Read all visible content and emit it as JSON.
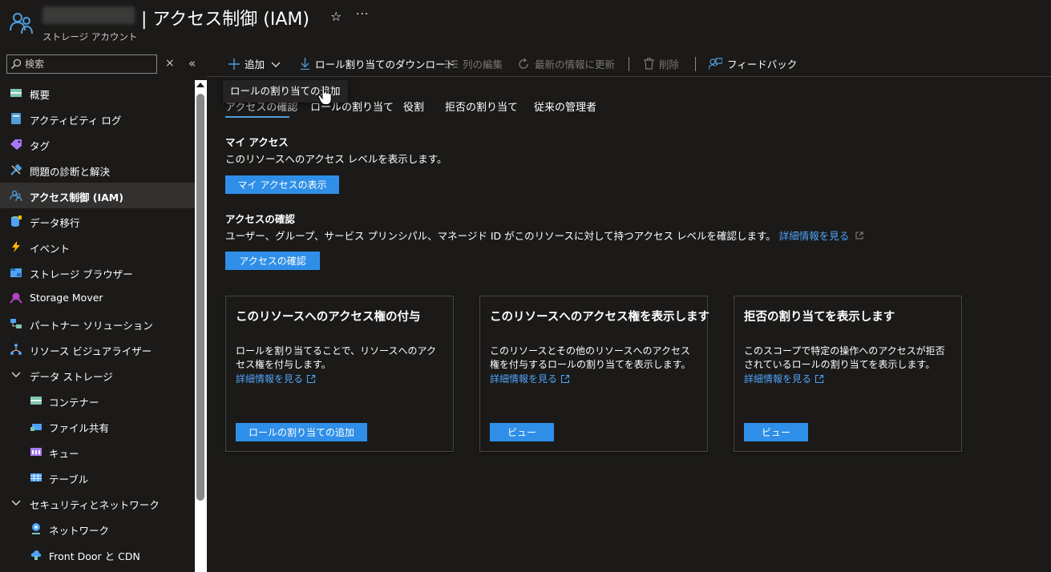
{
  "header": {
    "title": "| アクセス制御 (IAM)",
    "subtitle": "ストレージ アカウント",
    "favorite_icon": "star-icon",
    "more_icon": "ellipsis-icon"
  },
  "sidebar": {
    "search_placeholder": "検索",
    "items": [
      {
        "label": "概要",
        "icon": "overview-icon"
      },
      {
        "label": "アクティビティ ログ",
        "icon": "activity-log-icon"
      },
      {
        "label": "タグ",
        "icon": "tag-icon"
      },
      {
        "label": "問題の診断と解決",
        "icon": "wrench-icon"
      },
      {
        "label": "アクセス制御 (IAM)",
        "icon": "iam-icon"
      },
      {
        "label": "データ移行",
        "icon": "data-migration-icon"
      },
      {
        "label": "イベント",
        "icon": "lightning-icon"
      },
      {
        "label": "ストレージ ブラウザー",
        "icon": "storage-browser-icon"
      },
      {
        "label": "Storage Mover",
        "icon": "storage-mover-icon"
      },
      {
        "label": "パートナー ソリューション",
        "icon": "partner-icon"
      },
      {
        "label": "リソース ビジュアライザー",
        "icon": "visualizer-icon"
      },
      {
        "label": "データ ストレージ",
        "icon": "chevron-down-icon"
      },
      {
        "label": "コンテナー",
        "icon": "container-icon"
      },
      {
        "label": "ファイル共有",
        "icon": "file-share-icon"
      },
      {
        "label": "キュー",
        "icon": "queue-icon"
      },
      {
        "label": "テーブル",
        "icon": "table-icon"
      },
      {
        "label": "セキュリティとネットワーク",
        "icon": "chevron-down-icon"
      },
      {
        "label": "ネットワーク",
        "icon": "network-icon"
      },
      {
        "label": "Front Door と CDN",
        "icon": "front-door-icon"
      }
    ]
  },
  "toolbar": {
    "add": "追加",
    "download": "ロール割り当てのダウンロード",
    "edit_columns": "列の編集",
    "refresh": "最新の情報に更新",
    "delete": "削除",
    "feedback": "フィードバック"
  },
  "tooltip": "ロールの割り当ての追加",
  "tabs": [
    "アクセスの確認",
    "ロールの割り当て",
    "役割",
    "拒否の割り当て",
    "従来の管理者"
  ],
  "my_access": {
    "title": "マイ アクセス",
    "text": "このリソースへのアクセス レベルを表示します。",
    "button": "マイ アクセスの表示"
  },
  "check_access": {
    "title": "アクセスの確認",
    "text": "ユーザー、グループ、サービス プリンシパル、マネージド ID がこのリソースに対して持つアクセス レベルを確認します。",
    "link": "詳細情報を見る",
    "button": "アクセスの確認"
  },
  "cards": [
    {
      "title": "このリソースへのアクセス権の付与",
      "desc": "ロールを割り当てることで、リソースへのアクセス権を付与します。",
      "link": "詳細情報を見る",
      "button": "ロールの割り当ての追加"
    },
    {
      "title": "このリソースへのアクセス権を表示します",
      "desc": "このリソースとその他のリソースへのアクセス権を付与するロールの割り当てを表示します。",
      "link": "詳細情報を見る",
      "button": "ビュー"
    },
    {
      "title": "拒否の割り当てを表示します",
      "desc": "このスコープで特定の操作へのアクセスが拒否されているロールの割り当てを表示します。",
      "link": "詳細情報を見る",
      "button": "ビュー"
    }
  ],
  "colors": {
    "accent": "#2f8fe8",
    "link": "#4fa3f7",
    "background": "#1b1a19"
  }
}
